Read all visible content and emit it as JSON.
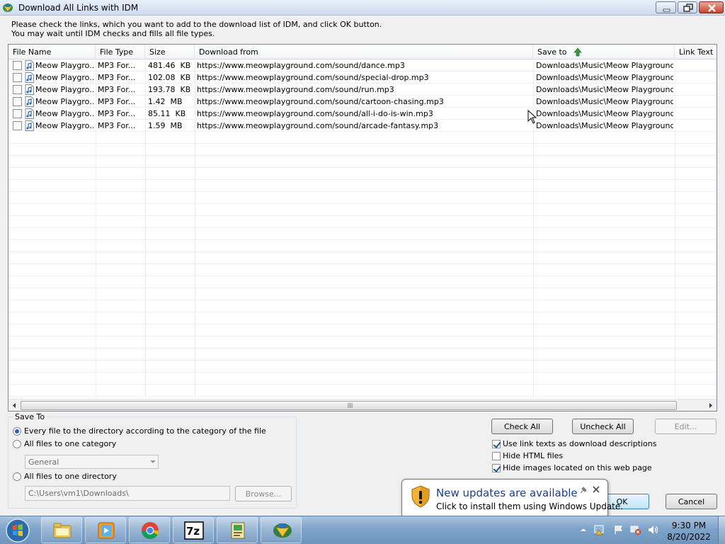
{
  "window": {
    "title": "Download All Links with IDM"
  },
  "instructions": {
    "line1": "Please check the links, which you want to add to the download list of IDM, and click OK button.",
    "line2": "You may wait until IDM checks and fills all file types."
  },
  "columns": {
    "file_name": "File Name",
    "file_type": "File Type",
    "size": "Size",
    "download_from": "Download from",
    "save_to": "Save to",
    "link_text": "Link Text"
  },
  "rows": [
    {
      "file_name": "Meow Playgro...",
      "file_type": "MP3 For...",
      "size": "481.46  KB",
      "url": "https://www.meowplayground.com/sound/dance.mp3",
      "save_to": "Downloads\\Music\\Meow Playground ...",
      "checked": false
    },
    {
      "file_name": "Meow Playgro...",
      "file_type": "MP3 For...",
      "size": "102.08  KB",
      "url": "https://www.meowplayground.com/sound/special-drop.mp3",
      "save_to": "Downloads\\Music\\Meow Playground ...",
      "checked": false
    },
    {
      "file_name": "Meow Playgro...",
      "file_type": "MP3 For...",
      "size": "193.78  KB",
      "url": "https://www.meowplayground.com/sound/run.mp3",
      "save_to": "Downloads\\Music\\Meow Playground ...",
      "checked": false
    },
    {
      "file_name": "Meow Playgro...",
      "file_type": "MP3 For...",
      "size": "1.42  MB",
      "url": "https://www.meowplayground.com/sound/cartoon-chasing.mp3",
      "save_to": "Downloads\\Music\\Meow Playground ...",
      "checked": false
    },
    {
      "file_name": "Meow Playgro...",
      "file_type": "MP3 For...",
      "size": "85.11  KB",
      "url": "https://www.meowplayground.com/sound/all-i-do-is-win.mp3",
      "save_to": "Downloads\\Music\\Meow Playground ...",
      "checked": false
    },
    {
      "file_name": "Meow Playgro...",
      "file_type": "MP3 For...",
      "size": "1.59  MB",
      "url": "https://www.meowplayground.com/sound/arcade-fantasy.mp3",
      "save_to": "Downloads\\Music\\Meow Playground ...",
      "checked": false
    }
  ],
  "save_to_group": {
    "title": "Save To",
    "option_category": "Every file to the directory according to the category of the file",
    "option_one_category": "All files to one category",
    "category_value": "General",
    "option_one_directory": "All files to one directory",
    "directory_value": "C:\\Users\\vm1\\Downloads\\",
    "browse_label": "Browse...",
    "selected": "category"
  },
  "buttons": {
    "check_all": "Check All",
    "uncheck_all": "Uncheck All",
    "edit": "Edit...",
    "ok": "OK",
    "cancel": "Cancel"
  },
  "options": {
    "use_link_texts": {
      "label": "Use link texts as download descriptions",
      "checked": true
    },
    "hide_html": {
      "label": "Hide HTML files",
      "checked": false
    },
    "hide_images": {
      "label": "Hide images located on this web page",
      "checked": true
    }
  },
  "notification": {
    "title": "New updates are available",
    "text": "Click to install them using Windows Update.",
    "icon": "shield-warning-icon"
  },
  "taskbar": {
    "apps": [
      "file-explorer-icon",
      "media-player-icon",
      "chrome-icon",
      "7zip-icon",
      "app-icon",
      "idm-icon"
    ],
    "time": "9:30 PM",
    "date": "8/20/2022"
  },
  "colors": {
    "accent": "#1c3f8c",
    "window_bg": "#f0f0f0",
    "taskbar": "#7ea3c9"
  }
}
